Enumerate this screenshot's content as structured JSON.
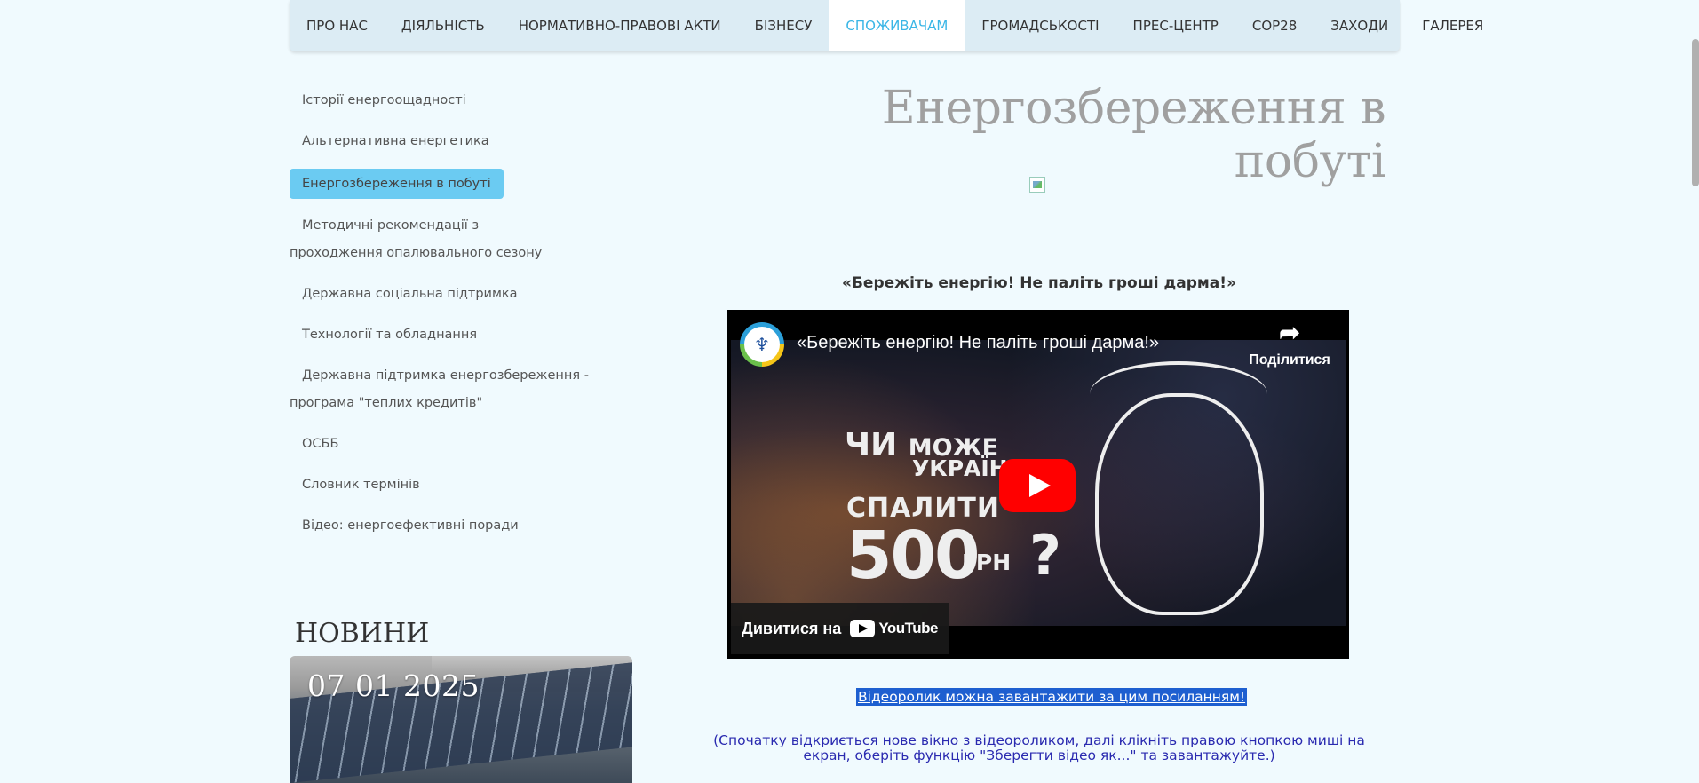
{
  "nav": {
    "items": [
      {
        "label": "ПРО НАС"
      },
      {
        "label": "ДІЯЛЬНІСТЬ"
      },
      {
        "label": "НОРМАТИВНО-ПРАВОВІ АКТИ"
      },
      {
        "label": "БІЗНЕСУ"
      },
      {
        "label": "СПОЖИВАЧАМ"
      },
      {
        "label": "ГРОМАДСЬКОСТІ"
      },
      {
        "label": "ПРЕС-ЦЕНТР"
      },
      {
        "label": "COP28"
      },
      {
        "label": "ЗАХОДИ"
      },
      {
        "label": "ГАЛЕРЕЯ"
      }
    ],
    "active": "СПОЖИВАЧАМ"
  },
  "sidebar": {
    "items": [
      {
        "label": "Історії енергоощадності"
      },
      {
        "label": "Альтернативна енергетика"
      },
      {
        "label": "Енергозбереження в побуті"
      },
      {
        "label": "Методичні рекомендації з проходження опалювального сезону"
      },
      {
        "label": "Державна соціальна підтримка"
      },
      {
        "label": "Технології та обладнання"
      },
      {
        "label": "Державна підтримка енергозбереження - програма \"теплих кредитів\""
      },
      {
        "label": "ОСББ"
      },
      {
        "label": "Словник термінів"
      },
      {
        "label": "Відео: енергоефективні поради"
      }
    ],
    "active": "Енергозбереження в побуті"
  },
  "news": {
    "title": "НОВИНИ",
    "card_date": "07 01 2025"
  },
  "main": {
    "title": "Енергозбереження в побуті",
    "quote": "«Бережіть енергію! Не паліть гроші дарма!»",
    "video": {
      "title": "«Бережіть енергію! Не паліть гроші дарма!»",
      "share_label": "Поділитися",
      "watch_on": "Дивитися на",
      "youtube": "YouTube",
      "thumb_line1": "ЧИ",
      "thumb_line1b": "МОЖЕ",
      "thumb_line2": "УКРАЇНЕЦЬ",
      "thumb_line3": "СПАЛИТИ",
      "thumb_line4": "500",
      "thumb_line5": "ГРН",
      "thumb_q": "?",
      "logo_glyph": "♆"
    },
    "download_link": "Відеоролик можна завантажити за цим посиланням!",
    "note": "(Спочатку відкриється нове вікно з відеороликом, далі клікніть правою кнопкою миші на екран, оберіть функцію \"Зберегти відео як...\" та завантажуйте.)"
  },
  "colors": {
    "background": "#f0fafe",
    "active_nav": "#3ab6e6",
    "active_side": "#6bcbf2",
    "link_highlight": "#1e5fd0",
    "note_text": "#2a2ab0"
  }
}
